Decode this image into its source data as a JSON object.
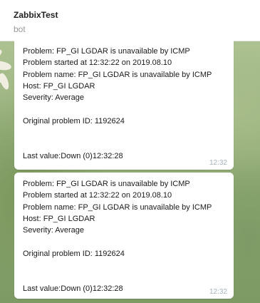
{
  "chat": {
    "title": "ZabbixTest",
    "subtitle": "bot"
  },
  "messages": [
    {
      "line_problem": "Problem: FP_GI LGDAR is unavailable by ICMP",
      "line_started": "Problem started at 12:32:22 on 2019.08.10",
      "line_name": "Problem name: FP_GI LGDAR is unavailable by ICMP",
      "line_host": "Host: FP_GI LGDAR",
      "line_severity": "Severity: Average",
      "line_original_id": "Original problem ID: 1192624",
      "line_last_value": "Last value:Down (0)12:32:28",
      "time": "12:32"
    },
    {
      "line_problem": "Problem: FP_GI LGDAR is unavailable by ICMP",
      "line_started": "Problem started at 12:32:22 on 2019.08.10",
      "line_name": "Problem name: FP_GI LGDAR is unavailable by ICMP",
      "line_host": "Host: FP_GI LGDAR",
      "line_severity": "Severity: Average",
      "line_original_id": "Original problem ID: 1192624",
      "line_last_value": "Last value:Down (0)12:32:28",
      "time": "12:32"
    }
  ],
  "icons": {
    "wallpaper_flower": "daisy-flower-icon"
  },
  "colors": {
    "header_bg": "#ffffff",
    "bubble_bg": "#ffffff",
    "time_text": "#a6b2bd",
    "subtitle_text": "#9a9a9a"
  }
}
